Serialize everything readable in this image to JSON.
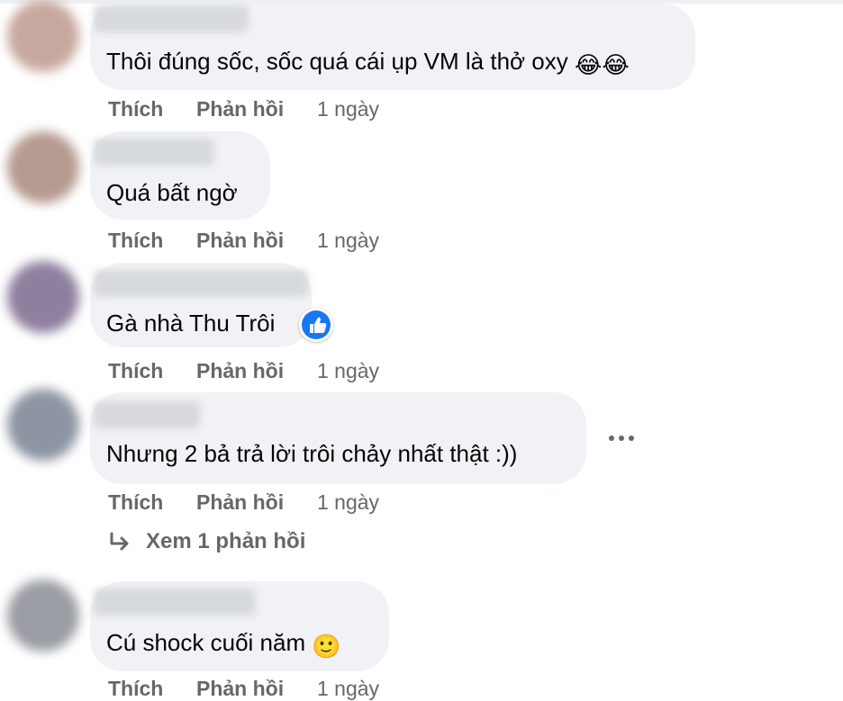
{
  "comments": [
    {
      "text": "Thôi đúng sốc, sốc quá cái ụp VM là thở oxy",
      "emoji": "😂😂",
      "actions": {
        "like": "Thích",
        "reply": "Phản hồi",
        "time": "1 ngày"
      }
    },
    {
      "text": "Quá bất ngờ",
      "actions": {
        "like": "Thích",
        "reply": "Phản hồi",
        "time": "1 ngày"
      }
    },
    {
      "text": "Gà nhà Thu Trôi",
      "reaction": "like-reaction",
      "actions": {
        "like": "Thích",
        "reply": "Phản hồi",
        "time": "1 ngày"
      }
    },
    {
      "text": "Nhưng 2 bả trả lời trôi chảy nhất thật :))",
      "actions": {
        "like": "Thích",
        "reply": "Phản hồi",
        "time": "1 ngày"
      },
      "view_replies": "Xem 1 phản hồi"
    },
    {
      "text": "Cú shock cuối năm",
      "emoji": "🙂",
      "actions": {
        "like": "Thích",
        "reply": "Phản hồi",
        "time": "1 ngày"
      }
    }
  ],
  "icons": {
    "more": "more-options-icon",
    "reply_arrow": "reply-arrow-icon",
    "like_reaction": "thumbs-up-icon"
  },
  "colors": {
    "bubble": "#f0f2f5",
    "meta_text": "#65676b",
    "like_blue": "#1877f2"
  }
}
